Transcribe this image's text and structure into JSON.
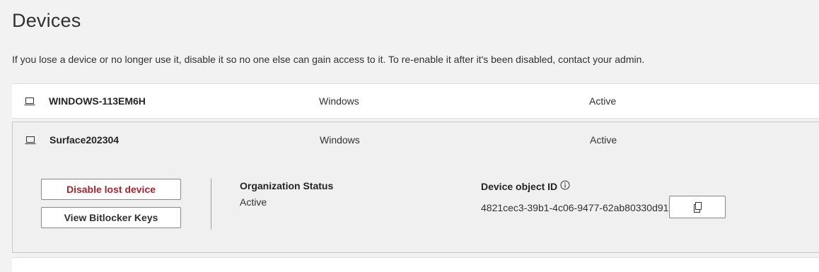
{
  "page": {
    "title": "Devices",
    "intro": "If you lose a device or no longer use it, disable it so no one else can gain access to it. To re-enable it after it's been disabled, contact your admin."
  },
  "devices": [
    {
      "icon": "laptop-icon",
      "name": "WINDOWS-113EM6H",
      "os": "Windows",
      "status": "Active",
      "expanded": false
    },
    {
      "icon": "laptop-icon",
      "name": "Surface202304",
      "os": "Windows",
      "status": "Active",
      "expanded": true
    }
  ],
  "details": {
    "disable_button": "Disable lost device",
    "bitlocker_button": "View Bitlocker Keys",
    "org_status_label": "Organization Status",
    "org_status_value": "Active",
    "device_id_label": "Device object ID",
    "device_id_info_icon": "info-icon",
    "device_id_value": "4821cec3-39b1-4c06-9477-62ab80330d91",
    "copy_icon": "copy-icon"
  },
  "colors": {
    "danger_text": "#a4262c",
    "page_background": "#f2f2f2",
    "row_background": "#ffffff",
    "expanded_background": "#f0f0f0"
  }
}
